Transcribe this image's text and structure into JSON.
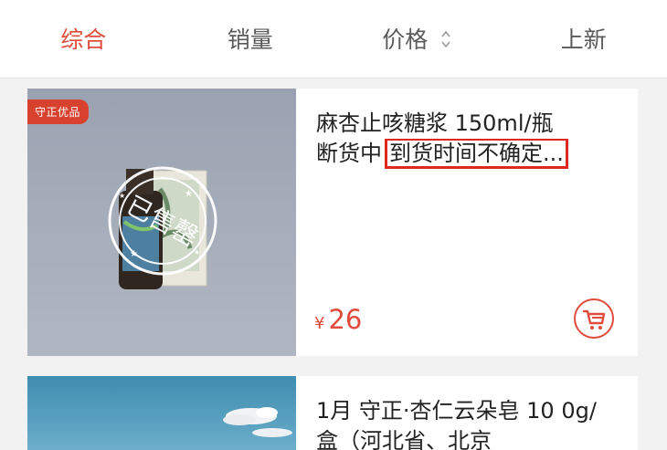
{
  "tabs": [
    {
      "label": "综合",
      "active": true
    },
    {
      "label": "销量",
      "active": false
    },
    {
      "label": "价格",
      "active": false
    },
    {
      "label": "上新",
      "active": false
    }
  ],
  "products": [
    {
      "badge": "守正优品",
      "title_line1": "麻杏止咳糖浆 150ml/瓶",
      "title_line2_prefix": "断货中",
      "title_line2_highlight": "到货时间不确定...",
      "stamp_text": "已售罄",
      "price_symbol": "¥",
      "price": "26",
      "cart_icon": "cart-icon"
    },
    {
      "title_line1": "1月 守正·杏仁云朵皂 10",
      "title_line2": "0g/盒（河北省、北京"
    }
  ],
  "colors": {
    "accent": "#e04b3c",
    "highlight_box": "#e0291e",
    "badge_bg": "#d9412f"
  }
}
